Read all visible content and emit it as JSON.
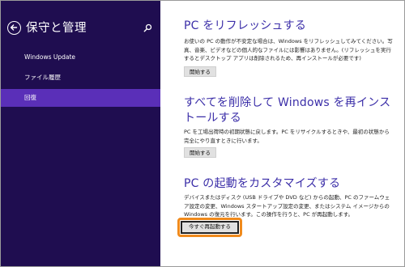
{
  "sidebar": {
    "title": "保守と管理",
    "back_icon": "back-arrow-icon",
    "search_icon": "search-icon",
    "items": [
      {
        "label": "Windows Update",
        "selected": false
      },
      {
        "label": "ファイル履歴",
        "selected": false
      },
      {
        "label": "回復",
        "selected": true
      }
    ]
  },
  "sections": [
    {
      "heading": "PC をリフレッシュする",
      "description": "お使いの PC の動作が不安定な場合は、Windows をリフレッシュしてみてください。写真、音楽、ビデオなどの個人的なファイルには影響はありません。(リフレッシュを実行するとデスクトップ アプリは削除されるため、再インストールが必要です)",
      "button": "開始する"
    },
    {
      "heading": "すべてを削除して Windows を再インストールする",
      "description": "PC を工場出荷時の初期状態に戻します。PC をリサイクルするときや、最初の状態から完全にやり直すときに行います。",
      "button": "開始する"
    },
    {
      "heading": "PC の起動をカスタマイズする",
      "description": "デバイスまたはディスク (USB ドライブや DVD など) からの起動、PC のファームウェア設定の変更、Windows スタートアップ設定の変更、またはシステム イメージからの Windows の復元を行います。この操作を行うと、PC が再起動します。",
      "button": "今すぐ再起動する"
    }
  ],
  "colors": {
    "sidebar_bg": "#1f0d50",
    "selected_bg": "#5a2fb8",
    "heading": "#3b2ea8",
    "highlight": "#f08a1c"
  }
}
